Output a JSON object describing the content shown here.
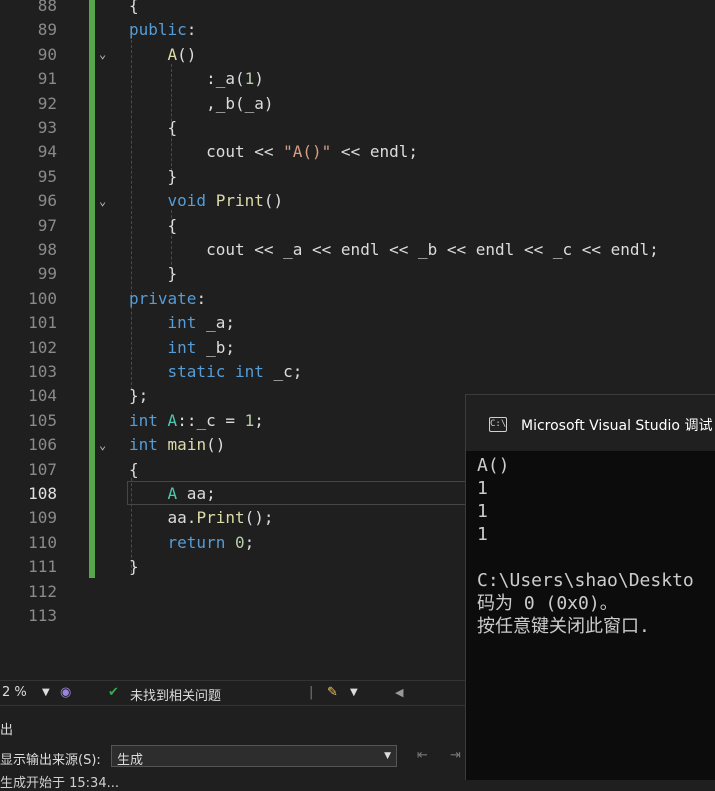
{
  "editor": {
    "lines": [
      {
        "num": "88",
        "tokens": [
          {
            "t": "{",
            "c": "pl"
          }
        ]
      },
      {
        "num": "89",
        "tokens": [
          {
            "t": "public",
            "c": "kw"
          },
          {
            "t": ":",
            "c": "pl"
          }
        ]
      },
      {
        "num": "90",
        "tokens": [
          {
            "t": "    ",
            "c": "pl"
          },
          {
            "t": "A",
            "c": "fn"
          },
          {
            "t": "()",
            "c": "pl"
          }
        ]
      },
      {
        "num": "91",
        "tokens": [
          {
            "t": "        :_a(",
            "c": "pl"
          },
          {
            "t": "1",
            "c": "num"
          },
          {
            "t": ")",
            "c": "pl"
          }
        ]
      },
      {
        "num": "92",
        "tokens": [
          {
            "t": "        ,_b(_a)",
            "c": "pl"
          }
        ]
      },
      {
        "num": "93",
        "tokens": [
          {
            "t": "    {",
            "c": "pl"
          }
        ]
      },
      {
        "num": "94",
        "tokens": [
          {
            "t": "        cout << ",
            "c": "pl"
          },
          {
            "t": "\"A()\"",
            "c": "str"
          },
          {
            "t": " << endl;",
            "c": "pl"
          }
        ]
      },
      {
        "num": "95",
        "tokens": [
          {
            "t": "    }",
            "c": "pl"
          }
        ]
      },
      {
        "num": "96",
        "tokens": [
          {
            "t": "    ",
            "c": "pl"
          },
          {
            "t": "void",
            "c": "kw"
          },
          {
            "t": " ",
            "c": "pl"
          },
          {
            "t": "Print",
            "c": "fn"
          },
          {
            "t": "()",
            "c": "pl"
          }
        ]
      },
      {
        "num": "97",
        "tokens": [
          {
            "t": "    {",
            "c": "pl"
          }
        ]
      },
      {
        "num": "98",
        "tokens": [
          {
            "t": "        cout << _a << endl << _b << endl << _c << endl;",
            "c": "pl"
          }
        ]
      },
      {
        "num": "99",
        "tokens": [
          {
            "t": "    }",
            "c": "pl"
          }
        ]
      },
      {
        "num": "100",
        "tokens": [
          {
            "t": "private",
            "c": "kw"
          },
          {
            "t": ":",
            "c": "pl"
          }
        ]
      },
      {
        "num": "101",
        "tokens": [
          {
            "t": "    ",
            "c": "pl"
          },
          {
            "t": "int",
            "c": "kw"
          },
          {
            "t": " _a;",
            "c": "pl"
          }
        ]
      },
      {
        "num": "102",
        "tokens": [
          {
            "t": "    ",
            "c": "pl"
          },
          {
            "t": "int",
            "c": "kw"
          },
          {
            "t": " _b;",
            "c": "pl"
          }
        ]
      },
      {
        "num": "103",
        "tokens": [
          {
            "t": "    ",
            "c": "pl"
          },
          {
            "t": "static",
            "c": "kw"
          },
          {
            "t": " ",
            "c": "pl"
          },
          {
            "t": "int",
            "c": "kw"
          },
          {
            "t": " _c;",
            "c": "pl"
          }
        ]
      },
      {
        "num": "104",
        "tokens": [
          {
            "t": "};",
            "c": "pl"
          }
        ]
      },
      {
        "num": "105",
        "tokens": [
          {
            "t": "int",
            "c": "kw"
          },
          {
            "t": " ",
            "c": "pl"
          },
          {
            "t": "A",
            "c": "ty"
          },
          {
            "t": "::_c = ",
            "c": "pl"
          },
          {
            "t": "1",
            "c": "num"
          },
          {
            "t": ";",
            "c": "pl"
          }
        ]
      },
      {
        "num": "106",
        "tokens": [
          {
            "t": "int",
            "c": "kw"
          },
          {
            "t": " ",
            "c": "pl"
          },
          {
            "t": "main",
            "c": "fn"
          },
          {
            "t": "()",
            "c": "pl"
          }
        ]
      },
      {
        "num": "107",
        "tokens": [
          {
            "t": "{",
            "c": "pl"
          }
        ]
      },
      {
        "num": "108",
        "tokens": [
          {
            "t": "    ",
            "c": "pl"
          },
          {
            "t": "A",
            "c": "ty"
          },
          {
            "t": " aa;",
            "c": "pl"
          }
        ]
      },
      {
        "num": "109",
        "tokens": [
          {
            "t": "    aa.",
            "c": "pl"
          },
          {
            "t": "Print",
            "c": "fn"
          },
          {
            "t": "();",
            "c": "pl"
          }
        ]
      },
      {
        "num": "110",
        "tokens": [
          {
            "t": "    ",
            "c": "pl"
          },
          {
            "t": "return",
            "c": "kw"
          },
          {
            "t": " ",
            "c": "pl"
          },
          {
            "t": "0",
            "c": "num"
          },
          {
            "t": ";",
            "c": "pl"
          }
        ]
      },
      {
        "num": "111",
        "tokens": [
          {
            "t": "}",
            "c": "pl"
          }
        ]
      },
      {
        "num": "112",
        "tokens": []
      },
      {
        "num": "113",
        "tokens": []
      }
    ]
  },
  "console": {
    "title": "Microsoft Visual Studio 调试",
    "icon": "console-icon",
    "lines": [
      "A()",
      "1",
      "1",
      "1",
      "",
      "C:\\Users\\shao\\Deskto",
      "码为 0 (0x0)。",
      "按任意键关闭此窗口."
    ]
  },
  "statusbar": {
    "zoom": "2 %",
    "issues": "未找到相关问题"
  },
  "output": {
    "title": "出",
    "source_label": "显示输出来源(S):",
    "source_value": "生成",
    "partial_line": "生成开始于 15:34..."
  },
  "colors": {
    "keyword": "#569cd6",
    "type": "#4ec9b0",
    "function": "#dcdcaa",
    "string": "#d69d85",
    "number": "#b5cea8",
    "change_bar": "#57a64a"
  }
}
